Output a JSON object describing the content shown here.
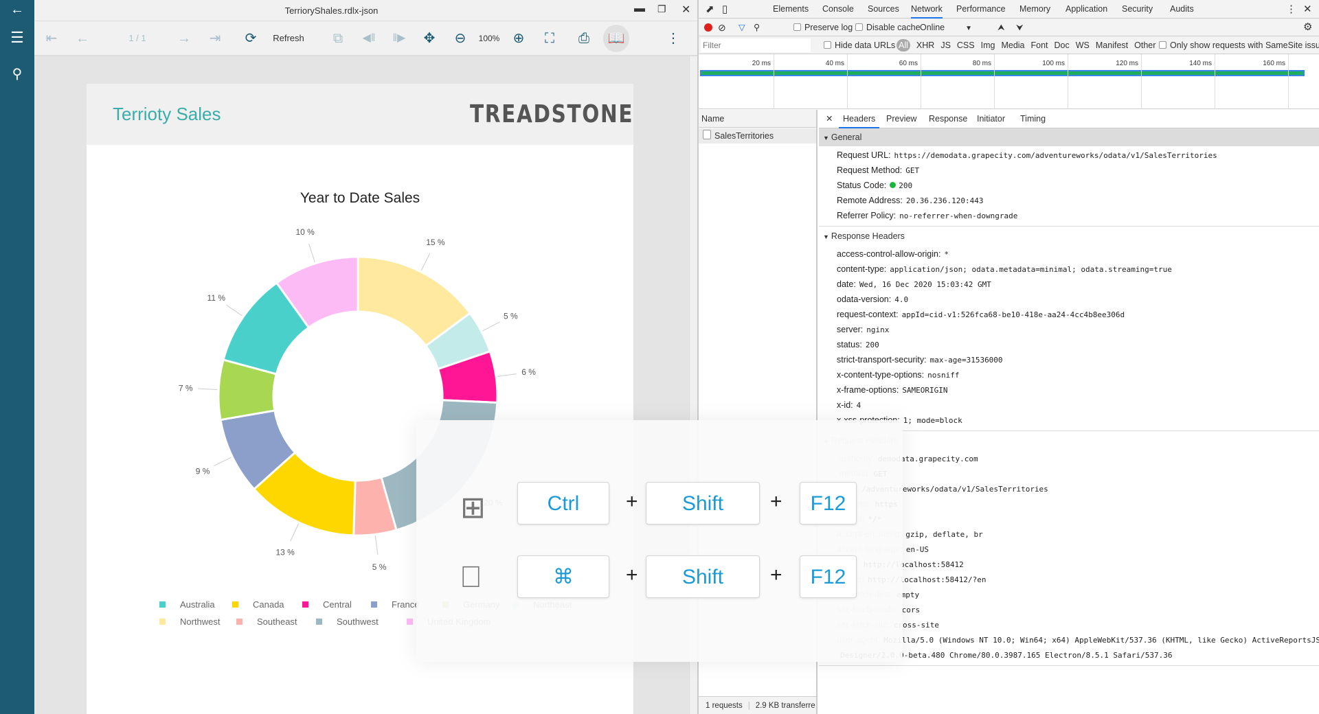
{
  "app": {
    "window_title": "TerrioryShales.rdlx-json"
  },
  "toolbar": {
    "page_indicator": "1 / 1",
    "refresh_label": "Refresh",
    "zoom_level": "100%"
  },
  "report": {
    "title": "Terrioty Sales",
    "logo_text": "TREADSTONE",
    "accent": "#3aada8"
  },
  "chart_data": {
    "type": "pie",
    "subtype": "donut",
    "title": "Year to Date Sales",
    "legend_position": "bottom",
    "slices": [
      {
        "label": "Northwest",
        "value": 15,
        "color": "#fee99e"
      },
      {
        "label": "Northeast",
        "value": 5,
        "color": "#c3ebea"
      },
      {
        "label": "Central",
        "value": 6,
        "color": "#ff1694"
      },
      {
        "label": "Southwest",
        "value": 20,
        "color": "#9eb8c2"
      },
      {
        "label": "Southeast",
        "value": 5,
        "color": "#feb2ad"
      },
      {
        "label": "Canada",
        "value": 13,
        "color": "#fed700"
      },
      {
        "label": "France",
        "value": 9,
        "color": "#8c9fcb"
      },
      {
        "label": "Germany",
        "value": 7,
        "color": "#a8d752"
      },
      {
        "label": "Australia",
        "value": 11,
        "color": "#4ad0cb"
      },
      {
        "label": "United Kingdom",
        "value": 10,
        "color": "#fdbbf6"
      }
    ],
    "legend": [
      "Australia",
      "Canada",
      "Central",
      "France",
      "Germany",
      "Northeast",
      "Northwest",
      "Southeast",
      "Southwest",
      "United Kingdom"
    ],
    "data_label_suffix": " %"
  },
  "devtools": {
    "tabs": [
      "Elements",
      "Console",
      "Sources",
      "Network",
      "Performance",
      "Memory",
      "Application",
      "Security",
      "Audits"
    ],
    "active_tab": "Network",
    "preserve_log": "Preserve log",
    "disable_cache": "Disable cache",
    "throttle": "Online",
    "filter_placeholder": "Filter",
    "hide_data_urls": "Hide data URLs",
    "types": [
      "All",
      "XHR",
      "JS",
      "CSS",
      "Img",
      "Media",
      "Font",
      "Doc",
      "WS",
      "Manifest",
      "Other"
    ],
    "samesite": "Only show requests with SameSite issues",
    "timeline_ticks": [
      "20 ms",
      "40 ms",
      "60 ms",
      "80 ms",
      "100 ms",
      "120 ms",
      "140 ms",
      "160 ms"
    ],
    "name_header": "Name",
    "request_name": "SalesTerritories",
    "status_bar": [
      "1 requests",
      "2.9 KB transferre"
    ],
    "detail_tabs": [
      "Headers",
      "Preview",
      "Response",
      "Initiator",
      "Timing"
    ],
    "general_title": "General",
    "general": [
      {
        "k": "Request URL:",
        "v": "https://demodata.grapecity.com/adventureworks/odata/v1/SalesTerritories"
      },
      {
        "k": "Request Method:",
        "v": "GET"
      },
      {
        "k": "Status Code:",
        "v": "200"
      },
      {
        "k": "Remote Address:",
        "v": "20.36.236.120:443"
      },
      {
        "k": "Referrer Policy:",
        "v": "no-referrer-when-downgrade"
      }
    ],
    "response_title": "Response Headers",
    "response": [
      {
        "k": "access-control-allow-origin:",
        "v": "*"
      },
      {
        "k": "content-type:",
        "v": "application/json; odata.metadata=minimal; odata.streaming=true"
      },
      {
        "k": "date:",
        "v": "Wed, 16 Dec 2020 15:03:42 GMT"
      },
      {
        "k": "odata-version:",
        "v": "4.0"
      },
      {
        "k": "request-context:",
        "v": "appId=cid-v1:526fca68-be10-418e-aa24-4cc4b8ee306d"
      },
      {
        "k": "server:",
        "v": "nginx"
      },
      {
        "k": "status:",
        "v": "200"
      },
      {
        "k": "strict-transport-security:",
        "v": "max-age=31536000"
      },
      {
        "k": "x-content-type-options:",
        "v": "nosniff"
      },
      {
        "k": "x-frame-options:",
        "v": "SAMEORIGIN"
      },
      {
        "k": "x-id:",
        "v": "4"
      },
      {
        "k": "x-xss-protection:",
        "v": "1; mode=block"
      }
    ],
    "request_title": "Request Headers",
    "request": [
      {
        "k": ":authority:",
        "v": "demodata.grapecity.com"
      },
      {
        "k": ":method:",
        "v": "GET"
      },
      {
        "k": ":path:",
        "v": "/adventureworks/odata/v1/SalesTerritories"
      },
      {
        "k": ":scheme:",
        "v": "https"
      },
      {
        "k": "accept:",
        "v": "*/*"
      },
      {
        "k": "accept-encoding:",
        "v": "gzip, deflate, br"
      },
      {
        "k": "accept-language:",
        "v": "en-US"
      },
      {
        "k": "origin:",
        "v": "http://localhost:58412"
      },
      {
        "k": "referer:",
        "v": "http://localhost:58412/?en"
      },
      {
        "k": "sec-fetch-dest:",
        "v": "empty"
      },
      {
        "k": "sec-fetch-mode:",
        "v": "cors"
      },
      {
        "k": "sec-fetch-site:",
        "v": "cross-site"
      },
      {
        "k": "user-agent:",
        "v": "Mozilla/5.0 (Windows NT 10.0; Win64; x64) AppleWebKit/537.36 (KHTML, like Gecko) ActiveReportsJS"
      },
      {
        "k": "",
        "v": "Designer/2.0.0-beta.480 Chrome/80.0.3987.165 Electron/8.5.1 Safari/537.36"
      }
    ]
  },
  "shortcut": {
    "windows": [
      "Ctrl",
      "Shift",
      "F12"
    ],
    "mac": [
      "⌘",
      "Shift",
      "F12"
    ],
    "plus": "+",
    "key_color": "#1a9bd7"
  }
}
